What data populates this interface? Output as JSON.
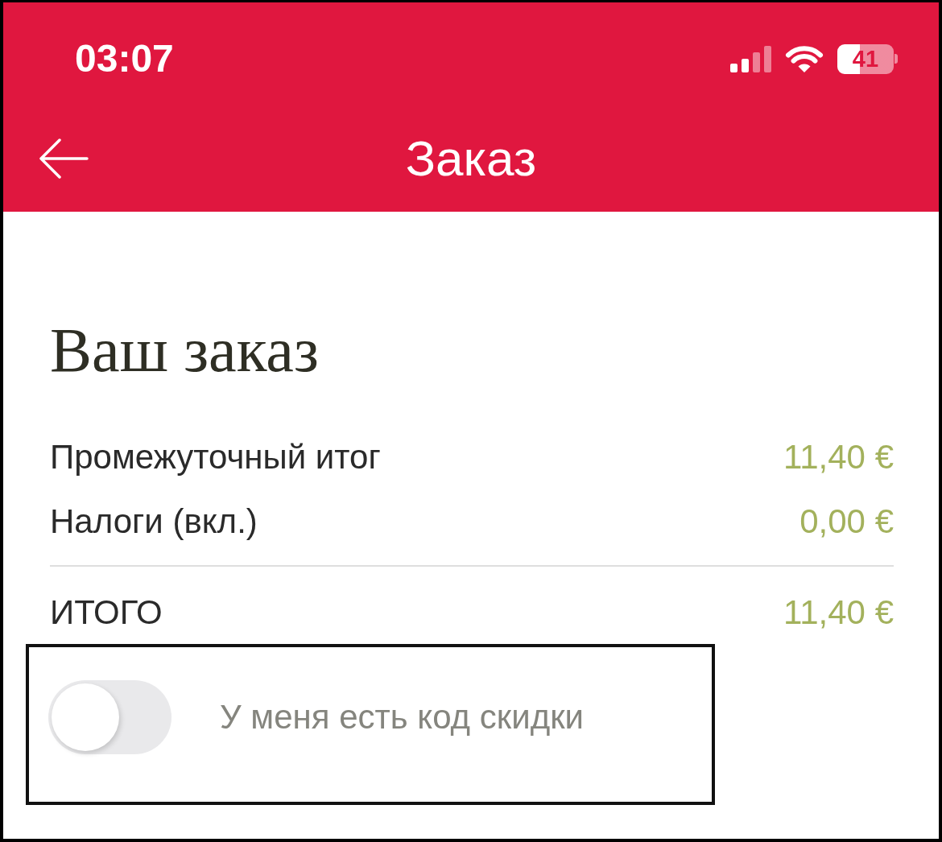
{
  "status_bar": {
    "time": "03:07",
    "battery": "41"
  },
  "nav_bar": {
    "title": "Заказ"
  },
  "order": {
    "heading": "Ваш заказ",
    "lines": [
      {
        "label": "Промежуточный итог",
        "value": "11,40 €"
      },
      {
        "label": "Налоги (вкл.)",
        "value": "0,00 €"
      }
    ],
    "total": {
      "label": "ИТОГО",
      "value": "11,40 €"
    }
  },
  "discount": {
    "label": "У меня есть код скидки",
    "on": false,
    "highlighted": true
  }
}
